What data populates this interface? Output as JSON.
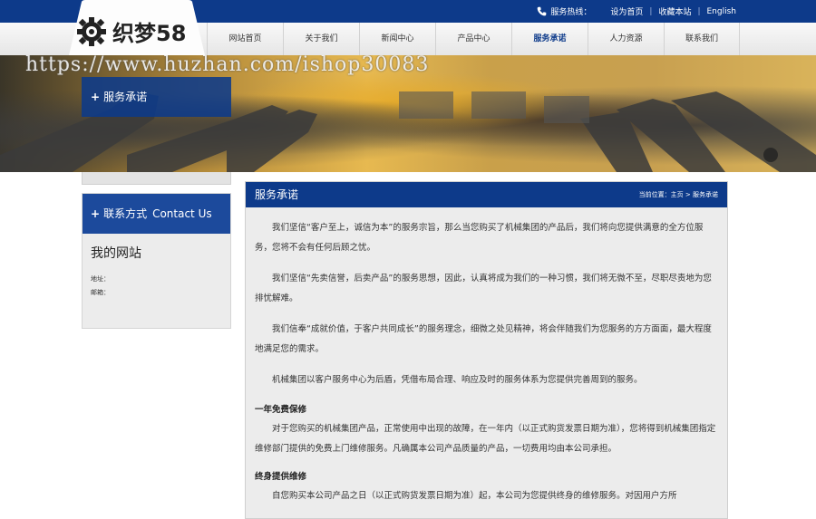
{
  "topbar": {
    "hotline_label": "服务热线：",
    "links": [
      "设为首页",
      "收藏本站",
      "English"
    ],
    "separator": "|"
  },
  "logo": {
    "text": "织梦58",
    "icon": "gear-icon"
  },
  "nav": {
    "items": [
      "网站首页",
      "关于我们",
      "新闻中心",
      "产品中心",
      "服务承诺",
      "人力资源",
      "联系我们"
    ],
    "active": "服务承诺"
  },
  "banner": {
    "watermark": "https://www.huzhan.com/ishop30083",
    "section_title": "服务承诺"
  },
  "sidebar": {
    "contact_title": "联系方式",
    "contact_title_en": "Contact Us",
    "site_name": "我的网站",
    "address_label": "地址：",
    "email_label": "邮箱："
  },
  "main": {
    "title": "服务承诺",
    "breadcrumb": "当前位置：主页 > 服务承诺",
    "paragraphs": [
      "我们坚信“客户至上，诚信为本”的服务宗旨，那么当您购买了机械集团的产品后，我们将向您提供满意的全方位服务，您将不会有任何后顾之忧。",
      "我们坚信“先卖信誉，后卖产品”的服务思想，因此，认真将成为我们的一种习惯，我们将无微不至，尽职尽责地为您排忧解难。",
      "我们信奉“成就价值，于客户共同成长”的服务理念，细微之处见精神，将会伴随我们为您服务的方方面面，最大程度地满足您的需求。",
      "机械集团以客户服务中心为后盾，凭借布局合理、响应及时的服务体系为您提供完善周到的服务。"
    ],
    "section1_title": "一年免费保修",
    "section1_text": "对于您购买的机械集团产品，正常使用中出现的故障，在一年内（以正式购货发票日期为准），您将得到机械集团指定维修部门提供的免费上门维修服务。凡确属本公司产品质量的产品，一切费用均由本公司承担。",
    "section2_title": "终身提供维修",
    "section2_text": "自您购买本公司产品之日（以正式购货发票日期为准）起，本公司为您提供终身的维修服务。对因用户方所"
  },
  "colors": {
    "primary": "#0d3a8a",
    "sidebar_header": "#1c4a9c",
    "panel_bg": "#ececec"
  }
}
